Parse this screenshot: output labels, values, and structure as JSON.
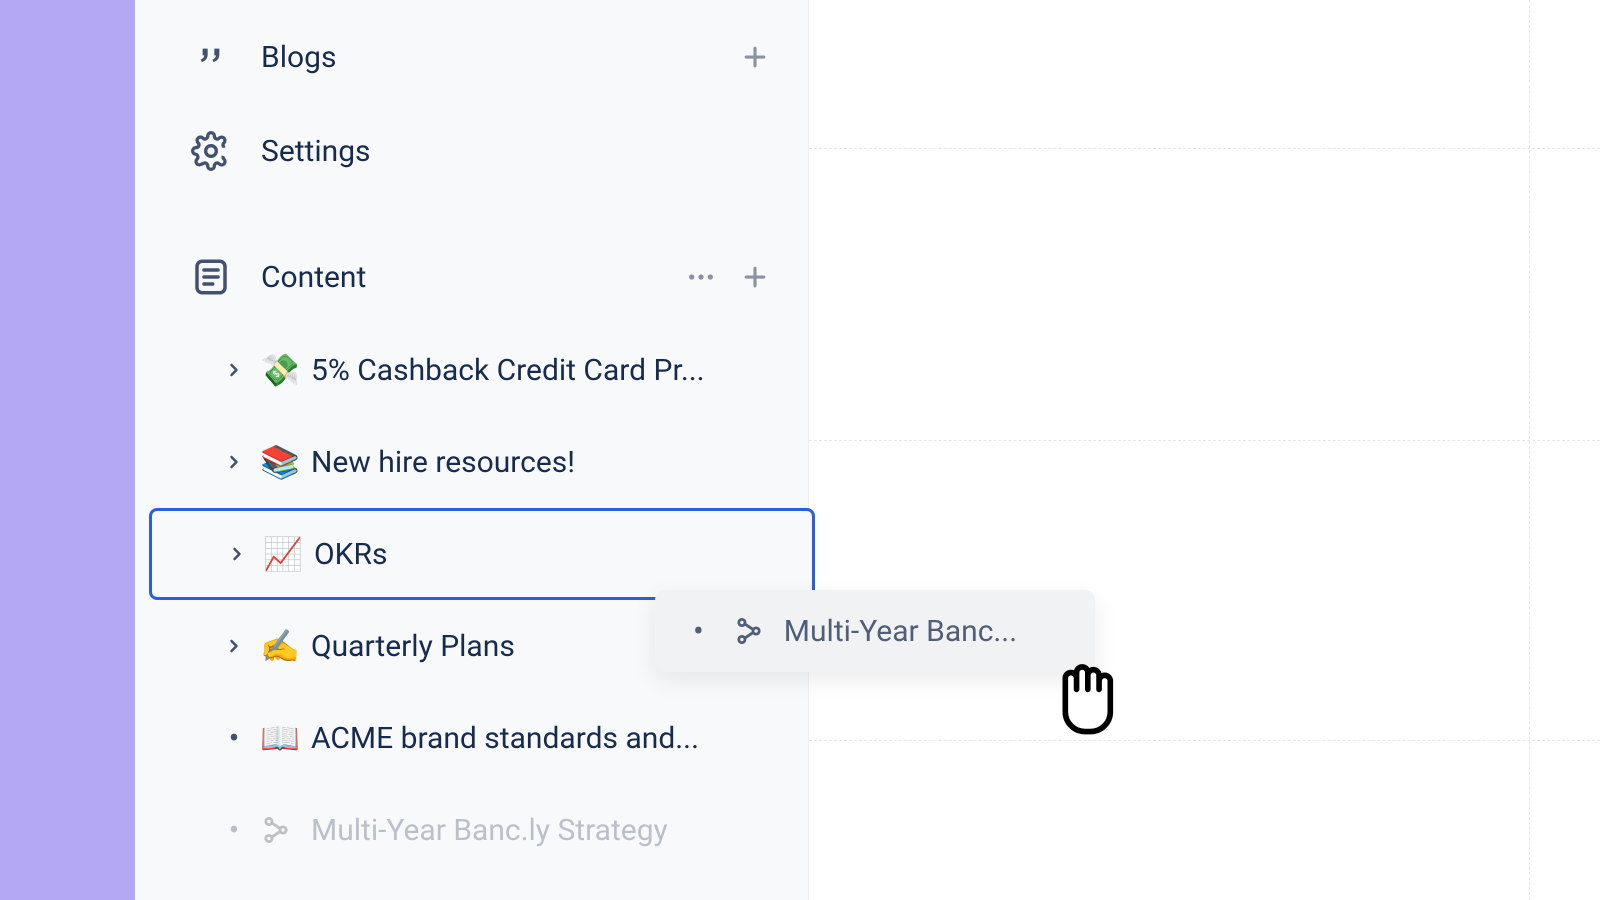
{
  "sidebar": {
    "blogs_label": "Blogs",
    "settings_label": "Settings",
    "content_label": "Content",
    "items": [
      {
        "emoji": "💸",
        "label": "5% Cashback Credit Card Pr..."
      },
      {
        "emoji": "📚",
        "label": "New hire resources!"
      },
      {
        "emoji": "📈",
        "label": "OKRs"
      },
      {
        "emoji": "✍️",
        "label": "Quarterly Plans"
      },
      {
        "emoji": "📖",
        "label": "ACME brand standards and..."
      },
      {
        "emoji": "",
        "label": "Multi-Year Banc.ly Strategy"
      }
    ]
  },
  "drag": {
    "label": "Multi-Year Banc..."
  }
}
